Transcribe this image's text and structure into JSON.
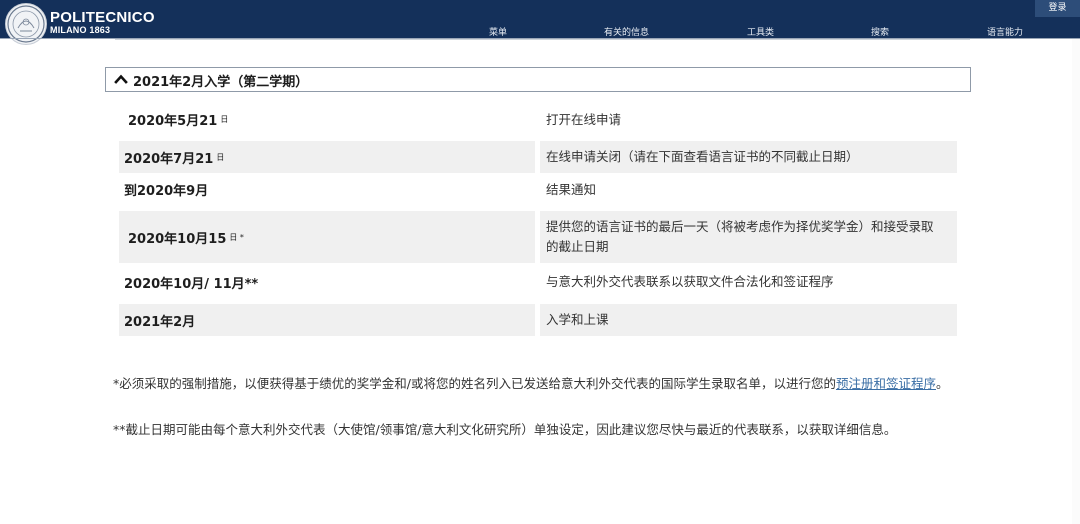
{
  "header": {
    "brand_line1": "POLITECNICO",
    "brand_line2": "MILANO 1863",
    "nav": [
      "菜单",
      "有关的信息",
      "工具类",
      "搜索",
      "语言能力"
    ],
    "login": "登录",
    "logo_icon": "university-seal-icon",
    "background": "#14305a"
  },
  "accordion": {
    "title": "2021年2月入学（第二学期）",
    "expanded": true,
    "icon": "chevron-up-icon"
  },
  "schedule": [
    {
      "date": "2020年5月21",
      "sup": "日",
      "event": "打开在线申请"
    },
    {
      "date": "2020年7月21",
      "sup": "日",
      "event": "在线申请关闭（请在下面查看语言证书的不同截止日期）"
    },
    {
      "date": "到2020年9月",
      "sup": "",
      "event": "结果通知"
    },
    {
      "date": "2020年10月15",
      "sup": "日 *",
      "event": "提供您的语言证书的最后一天（将被考虑作为择优奖学金）和接受录取的截止日期"
    },
    {
      "date": "2020年10月/ 11月**",
      "sup": "",
      "event": "与意大利外交代表联系以获取文件合法化和签证程序"
    },
    {
      "date": "2021年2月",
      "sup": "",
      "event": "入学和上课"
    }
  ],
  "notes": {
    "note1_text": "*必须采取的强制措施，以便获得基于绩优的奖学金和/或将您的姓名列入已发送给意大利外交代表的国际学生录取名单，以进行您的",
    "note1_link": "预注册和签证程序",
    "note1_end": "。",
    "note2_text": "**截止日期可能由每个意大利外交代表（大使馆/领事馆/意大利文化研究所）单独设定，因此建议您尽快与最近的代表联系，以获取详细信息。"
  }
}
